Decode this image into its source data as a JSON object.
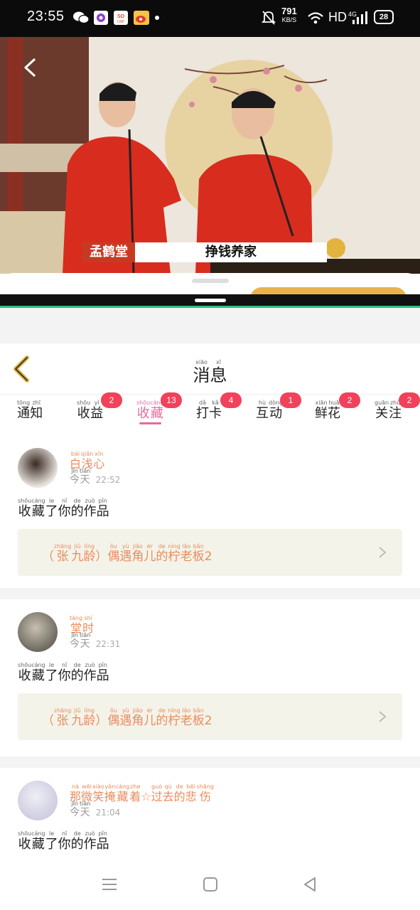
{
  "status_bar": {
    "time": "23:55",
    "net_speed_value": "791",
    "net_speed_unit": "KB/S",
    "hd_label": "HD",
    "battery": "28",
    "icons": [
      "wechat-icon",
      "app-icon",
      "soul-icon",
      "weibo-icon",
      "dot-icon",
      "mute-icon",
      "wifi-icon",
      "signal-4g-icon",
      "battery-icon"
    ]
  },
  "video": {
    "caption_name": "孟鹤堂",
    "caption_title": "挣钱养家"
  },
  "header": {
    "title_chars": [
      [
        "消",
        "xiāo"
      ],
      [
        "息",
        "xī"
      ]
    ]
  },
  "tabs": [
    {
      "chars": [
        [
          "通",
          "tōng"
        ],
        [
          "知",
          "zhī"
        ]
      ],
      "badge": ""
    },
    {
      "chars": [
        [
          "收",
          "shōu"
        ],
        [
          "益",
          "yì"
        ]
      ],
      "badge": "2"
    },
    {
      "chars": [
        [
          "收",
          "shōu"
        ],
        [
          "藏",
          "cáng"
        ]
      ],
      "badge": "13",
      "active": true
    },
    {
      "chars": [
        [
          "打",
          "dǎ"
        ],
        [
          "卡",
          "kǎ"
        ]
      ],
      "badge": "4"
    },
    {
      "chars": [
        [
          "互",
          "hù"
        ],
        [
          "动",
          "dòng"
        ]
      ],
      "badge": "1"
    },
    {
      "chars": [
        [
          "鲜",
          "xiān"
        ],
        [
          "花",
          "huā"
        ]
      ],
      "badge": "2"
    },
    {
      "chars": [
        [
          "关",
          "guān"
        ],
        [
          "注",
          "zhù"
        ]
      ],
      "badge": "2"
    }
  ],
  "messages": [
    {
      "user_chars": [
        [
          "白",
          "bái"
        ],
        [
          "浅",
          "qiǎn"
        ],
        [
          "心",
          "xīn"
        ]
      ],
      "day_chars": [
        [
          "今",
          "jīn"
        ],
        [
          "天",
          "tiān"
        ]
      ],
      "time": "22:52",
      "action_chars": [
        [
          "收",
          "shōu"
        ],
        [
          "藏",
          "cáng"
        ],
        [
          "了",
          "le"
        ],
        [
          "你",
          "nǐ"
        ],
        [
          "的",
          "de"
        ],
        [
          "作",
          "zuò"
        ],
        [
          "品",
          "pǐn"
        ]
      ],
      "work_chars": [
        [
          "（",
          ""
        ],
        [
          "张",
          "zhāng"
        ],
        [
          "九",
          "jiǔ"
        ],
        [
          "龄",
          "líng"
        ],
        [
          "）",
          ""
        ],
        [
          "偶",
          "ǒu"
        ],
        [
          "遇",
          "yù"
        ],
        [
          "角",
          "jiǎo"
        ],
        [
          "儿",
          "ér"
        ],
        [
          "的",
          "de"
        ],
        [
          "柠",
          "níng"
        ],
        [
          "老",
          "lǎo"
        ],
        [
          "板",
          "bǎn"
        ],
        [
          "2",
          ""
        ]
      ]
    },
    {
      "user_chars": [
        [
          "堂",
          "táng"
        ],
        [
          "时",
          "shí"
        ]
      ],
      "day_chars": [
        [
          "今",
          "jīn"
        ],
        [
          "天",
          "tiān"
        ]
      ],
      "time": "22:31",
      "action_chars": [
        [
          "收",
          "shōu"
        ],
        [
          "藏",
          "cáng"
        ],
        [
          "了",
          "le"
        ],
        [
          "你",
          "nǐ"
        ],
        [
          "的",
          "de"
        ],
        [
          "作",
          "zuò"
        ],
        [
          "品",
          "pǐn"
        ]
      ],
      "work_chars": [
        [
          "（",
          ""
        ],
        [
          "张",
          "zhāng"
        ],
        [
          "九",
          "jiǔ"
        ],
        [
          "龄",
          "líng"
        ],
        [
          "）",
          ""
        ],
        [
          "偶",
          "ǒu"
        ],
        [
          "遇",
          "yù"
        ],
        [
          "角",
          "jiǎo"
        ],
        [
          "儿",
          "ér"
        ],
        [
          "的",
          "de"
        ],
        [
          "柠",
          "níng"
        ],
        [
          "老",
          "lǎo"
        ],
        [
          "板",
          "bǎn"
        ],
        [
          "2",
          ""
        ]
      ]
    },
    {
      "user_chars": [
        [
          "那",
          "nà"
        ],
        [
          "微",
          "wēi"
        ],
        [
          "笑",
          "xiào"
        ],
        [
          "掩",
          "yǎn"
        ],
        [
          "藏",
          "cáng"
        ],
        [
          "着",
          "zhe"
        ],
        [
          "☆",
          ""
        ],
        [
          "过",
          "guò"
        ],
        [
          "去",
          "qù"
        ],
        [
          "的",
          "de"
        ],
        [
          "悲",
          "bēi"
        ],
        [
          "伤",
          "shāng"
        ]
      ],
      "day_chars": [
        [
          "今",
          "jīn"
        ],
        [
          "天",
          "tiān"
        ]
      ],
      "time": "21:04",
      "action_chars": [
        [
          "收",
          "shōu"
        ],
        [
          "藏",
          "cáng"
        ],
        [
          "了",
          "le"
        ],
        [
          "你",
          "nǐ"
        ],
        [
          "的",
          "de"
        ],
        [
          "作",
          "zuò"
        ],
        [
          "品",
          "pǐn"
        ]
      ],
      "work_chars": []
    }
  ],
  "colors": {
    "accent_pink": "#e46b9e",
    "badge_red": "#f2415a",
    "name_orange": "#e98c5c",
    "card_bg": "#f4f3ea"
  }
}
